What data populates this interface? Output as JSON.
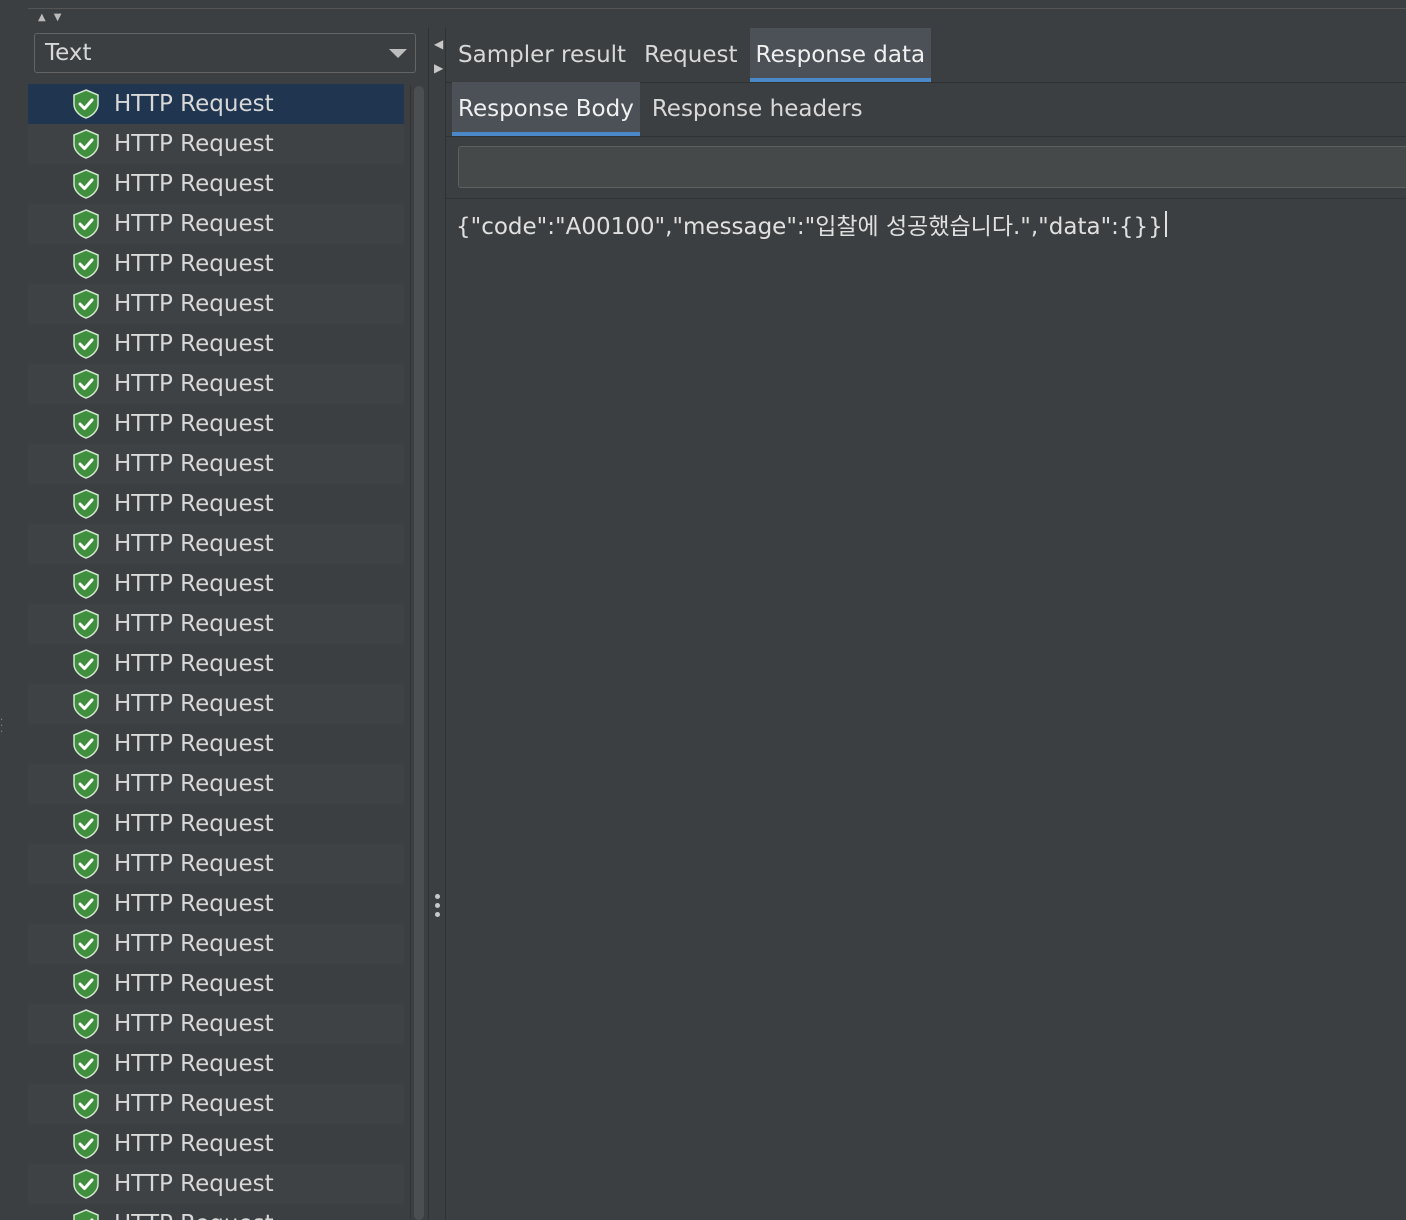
{
  "renderer": {
    "selected": "Text"
  },
  "results": {
    "item_label": "HTTP Request",
    "status_icon": "check-shield-icon",
    "items": [
      "HTTP Request",
      "HTTP Request",
      "HTTP Request",
      "HTTP Request",
      "HTTP Request",
      "HTTP Request",
      "HTTP Request",
      "HTTP Request",
      "HTTP Request",
      "HTTP Request",
      "HTTP Request",
      "HTTP Request",
      "HTTP Request",
      "HTTP Request",
      "HTTP Request",
      "HTTP Request",
      "HTTP Request",
      "HTTP Request",
      "HTTP Request",
      "HTTP Request",
      "HTTP Request",
      "HTTP Request",
      "HTTP Request",
      "HTTP Request",
      "HTTP Request",
      "HTTP Request",
      "HTTP Request",
      "HTTP Request",
      "HTTP Request"
    ],
    "selected_index": 0
  },
  "tabs": {
    "main": [
      "Sampler result",
      "Request",
      "Response data"
    ],
    "main_active": 2,
    "sub": [
      "Response Body",
      "Response headers"
    ],
    "sub_active": 0
  },
  "response": {
    "search_value": "",
    "body": "{\"code\":\"A00100\",\"message\":\"입찰에 성공했습니다.\",\"data\":{}}"
  },
  "colors": {
    "background": "#3c3f41",
    "selected_row": "#1f3550",
    "accent": "#4a88c7",
    "success_green": "#4caf50"
  }
}
